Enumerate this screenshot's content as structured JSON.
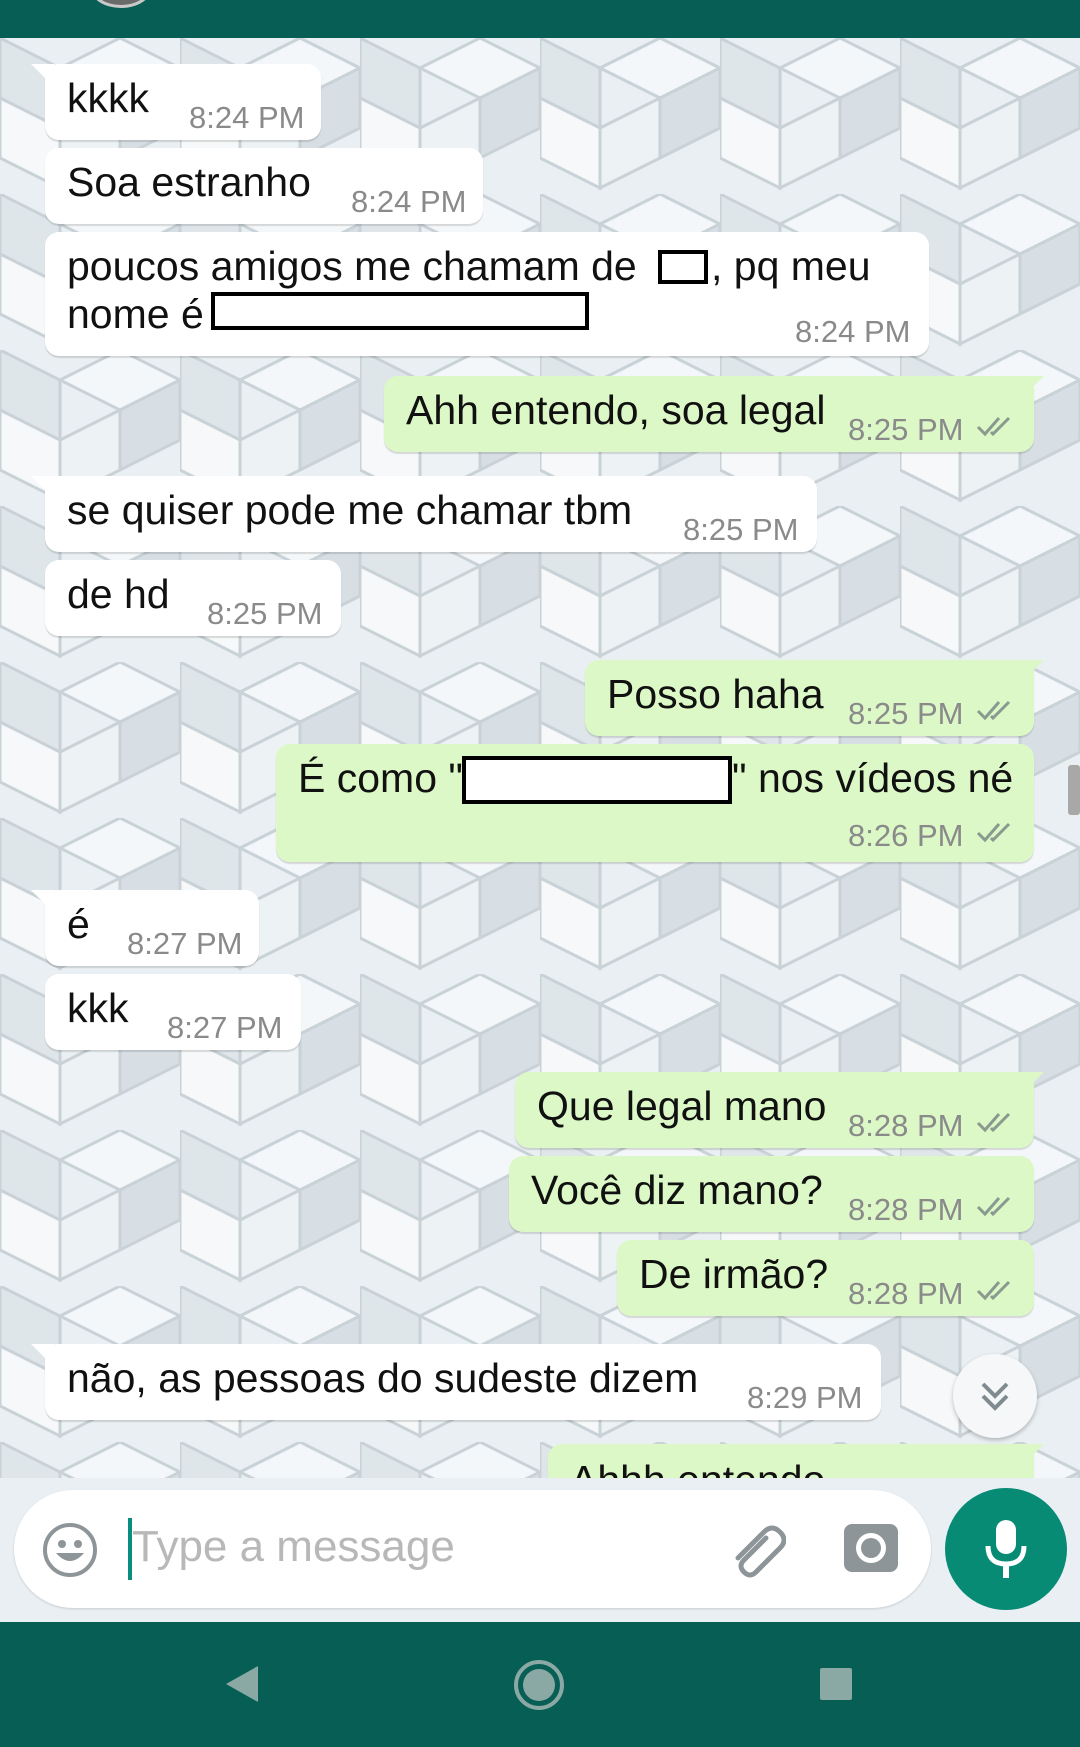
{
  "messages": [
    {
      "dir": "in",
      "text": "kkkk",
      "time": "8:24 PM"
    },
    {
      "dir": "in",
      "text": "Soa estranho",
      "time": "8:24 PM"
    },
    {
      "dir": "in",
      "line1a": "poucos amigos me chamam de",
      "line1b": ", pq meu",
      "line2": "nome é",
      "time": "8:24 PM"
    },
    {
      "dir": "out",
      "text": "Ahh entendo, soa legal",
      "time": "8:25 PM"
    },
    {
      "dir": "in",
      "text": "se quiser pode me chamar tbm",
      "time": "8:25 PM"
    },
    {
      "dir": "in",
      "text": "de hd",
      "time": "8:25 PM"
    },
    {
      "dir": "out",
      "text": "Posso haha",
      "time": "8:25 PM"
    },
    {
      "dir": "out",
      "pre": "É como \"",
      "post": "\" nos vídeos né",
      "time": "8:26 PM"
    },
    {
      "dir": "in",
      "text": "é",
      "time": "8:27 PM"
    },
    {
      "dir": "in",
      "text": "kkk",
      "time": "8:27 PM"
    },
    {
      "dir": "out",
      "text": "Que legal mano",
      "time": "8:28 PM"
    },
    {
      "dir": "out",
      "text": "Você diz mano?",
      "time": "8:28 PM"
    },
    {
      "dir": "out",
      "text": "De irmão?",
      "time": "8:28 PM"
    },
    {
      "dir": "in",
      "text": "não, as pessoas do sudeste dizem",
      "time": "8:29 PM"
    },
    {
      "dir": "out",
      "text": "Ahhh entendo",
      "time": ""
    }
  ],
  "composer": {
    "placeholder": "Type a message",
    "emoji_icon": "emoji-icon",
    "attach_icon": "paperclip-icon",
    "camera_icon": "camera-icon",
    "mic_icon": "mic-icon"
  },
  "colors": {
    "header": "#075e54",
    "incoming_bubble": "#ffffff",
    "outgoing_bubble": "#dcf8c6",
    "mic_button": "#078b75",
    "read_ticks": "#8a9a8e"
  },
  "navbar": {
    "back_icon": "back-triangle-icon",
    "home_icon": "home-circle-icon",
    "recents_icon": "recents-square-icon"
  }
}
